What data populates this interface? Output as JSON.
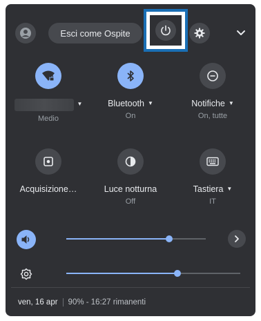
{
  "top_bar": {
    "guest_button_label": "Esci come Ospite",
    "icons": [
      "avatar-icon",
      "power-icon",
      "settings-gear-icon",
      "chevron-down-icon"
    ]
  },
  "pods": [
    {
      "label": "",
      "sublabel": "Medio",
      "icon": "wifi-lock-icon",
      "active": true,
      "has_menu": true
    },
    {
      "label": "Bluetooth",
      "sublabel": "On",
      "icon": "bluetooth-icon",
      "active": true,
      "has_menu": true
    },
    {
      "label": "Notifiche",
      "sublabel": "On, tutte",
      "icon": "notifications-icon",
      "active": false,
      "has_menu": true
    },
    {
      "label": "Acquisizione…",
      "sublabel": "",
      "icon": "screen-capture-icon",
      "active": false,
      "has_menu": false
    },
    {
      "label": "Luce notturna",
      "sublabel": "Off",
      "icon": "night-light-icon",
      "active": false,
      "has_menu": false
    },
    {
      "label": "Tastiera",
      "sublabel": "IT",
      "icon": "keyboard-icon",
      "active": false,
      "has_menu": true
    }
  ],
  "sliders": {
    "volume": {
      "icon": "volume-icon",
      "level": 0.74
    },
    "brightness": {
      "icon": "brightness-icon",
      "level": 0.64
    }
  },
  "footer": {
    "date": "ven, 16 apr",
    "battery": "90% - 16:27 rimanenti"
  },
  "colors": {
    "panel": "#2f3034",
    "accent": "#8ab4f8",
    "highlight": "#1a6fb5"
  }
}
